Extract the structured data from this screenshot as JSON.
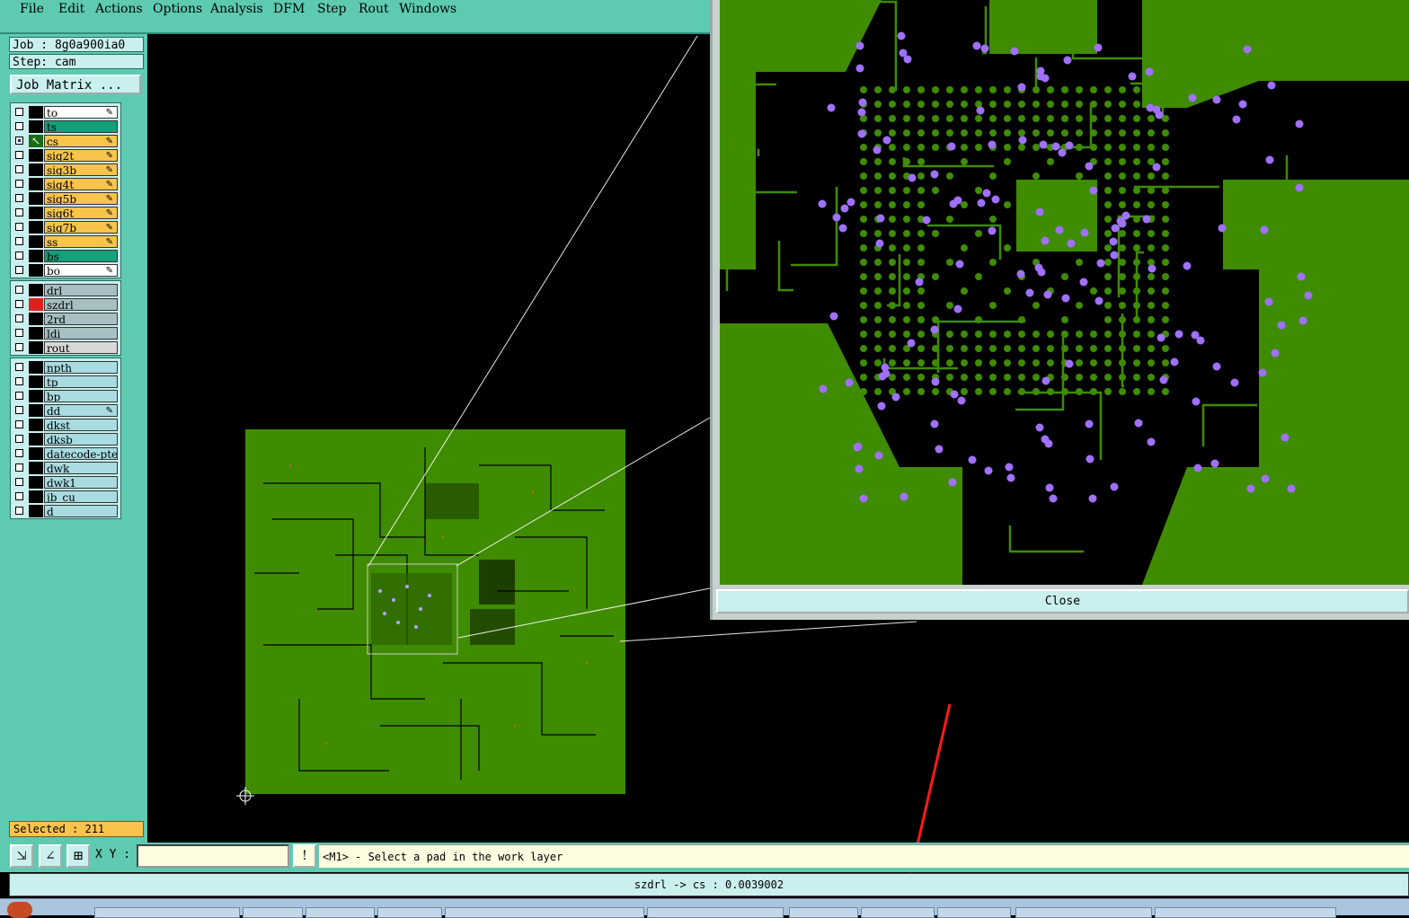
{
  "menu": [
    {
      "label": "File"
    },
    {
      "label": "Edit"
    },
    {
      "label": "Actions"
    },
    {
      "label": "Options"
    },
    {
      "label": "Analysis"
    },
    {
      "label": "DFM"
    },
    {
      "label": "Step"
    },
    {
      "label": "Rout"
    },
    {
      "label": "Windows"
    }
  ],
  "job": {
    "label": "Job : 8g0a900ia0"
  },
  "step": {
    "label": "Step: cam"
  },
  "job_matrix": {
    "label": "Job Matrix ..."
  },
  "layers_board": [
    {
      "name": "to",
      "color": "#ffffff",
      "editable": true
    },
    {
      "name": "ts",
      "color": "#14a07a",
      "editable": false
    },
    {
      "name": "cs",
      "color": "#f8c44c",
      "editable": true,
      "work": true
    },
    {
      "name": "sig2t",
      "color": "#f8c44c",
      "editable": true
    },
    {
      "name": "sig3b",
      "color": "#f8c44c",
      "editable": true
    },
    {
      "name": "sig4t",
      "color": "#f8c44c",
      "editable": true
    },
    {
      "name": "sig5b",
      "color": "#f8c44c",
      "editable": true
    },
    {
      "name": "sig6t",
      "color": "#f8c44c",
      "editable": true
    },
    {
      "name": "sig7b",
      "color": "#f8c44c",
      "editable": true
    },
    {
      "name": "ss",
      "color": "#f8c44c",
      "editable": true
    },
    {
      "name": "bs",
      "color": "#14a07a",
      "editable": false
    },
    {
      "name": "bo",
      "color": "#ffffff",
      "editable": true
    }
  ],
  "layers_drill": [
    {
      "name": "drl",
      "color": "#a8c0c4"
    },
    {
      "name": "szdrl",
      "color": "#a8c0c4",
      "marker": "#e0201c"
    },
    {
      "name": "2rd",
      "color": "#a8c0c4"
    },
    {
      "name": "ldi",
      "color": "#a8c0c4"
    },
    {
      "name": "rout",
      "color": "#d8d8d8"
    }
  ],
  "layers_misc": [
    {
      "name": "npth"
    },
    {
      "name": "tp"
    },
    {
      "name": "bp"
    },
    {
      "name": "dd",
      "editable": true
    },
    {
      "name": "dkst"
    },
    {
      "name": "dksb"
    },
    {
      "name": "datecode-pte"
    },
    {
      "name": "dwk"
    },
    {
      "name": "dwk1"
    },
    {
      "name": "jb_cu"
    },
    {
      "name": "d"
    }
  ],
  "selected": {
    "label": "Selected : 211"
  },
  "xy": {
    "label": "X Y :",
    "value": ""
  },
  "message": {
    "text": "<M1> - Select a pad in the work layer"
  },
  "status": {
    "text": "szdrl -> cs : 0.0039002"
  },
  "zoom": {
    "close_label": "Close"
  },
  "colors": {
    "panel": "#5ecab2",
    "board": "#3f8c00",
    "trace": "#000000",
    "via": "#a070ff",
    "annotation": "#ff1a1a"
  }
}
